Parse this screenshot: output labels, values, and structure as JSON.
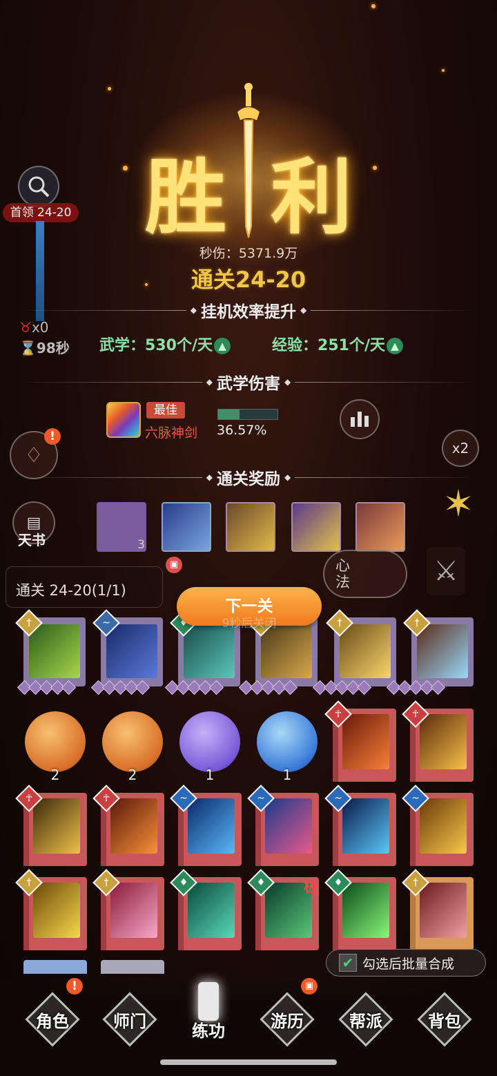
{
  "victory": {
    "char_left": "胜",
    "char_right": "利"
  },
  "dps": {
    "label": "秒伤：",
    "value": "5371.9万"
  },
  "clear_title": "通关24-20",
  "sections": {
    "idle_efficiency": "挂机效率提升",
    "martial_damage": "武学伤害",
    "clear_reward": "通关奖励"
  },
  "efficiency": {
    "martial_label": "武学：",
    "martial_value": "530个/天",
    "exp_label": "经验：",
    "exp_value": "251个/天"
  },
  "side": {
    "stage_pill": "首领 24-20",
    "demon_count": "x0",
    "timer": "98秒"
  },
  "martial_top": {
    "tag": "最佳",
    "name": "六脉神剑",
    "percent": "36.57%",
    "bar_fill": 0.3657
  },
  "speed_multiplier": "x2",
  "tianshu_label": "天书",
  "xinfa_label": "心法",
  "rewards": [
    {
      "count": "3"
    },
    {
      "count": ""
    },
    {
      "count": ""
    },
    {
      "count": ""
    },
    {
      "count": ""
    }
  ],
  "stage_progress": "通关 24-20(1/1)",
  "next_button": "下一关",
  "close_hint": "9秒后关闭",
  "orbs": [
    {
      "count": "2"
    },
    {
      "count": "2"
    },
    {
      "count": "1"
    },
    {
      "count": "1"
    }
  ],
  "extreme_tag": "极",
  "batch_label": "勾选后批量合成",
  "nav": [
    {
      "label": "角色"
    },
    {
      "label": "师门"
    },
    {
      "label": "练功"
    },
    {
      "label": "游历"
    },
    {
      "label": "帮派"
    },
    {
      "label": "背包"
    }
  ],
  "colors": {
    "gold": "#f0c64a",
    "green": "#8fe0a8",
    "orange_button": "#f07a1a",
    "red_card": "#c9575a"
  }
}
